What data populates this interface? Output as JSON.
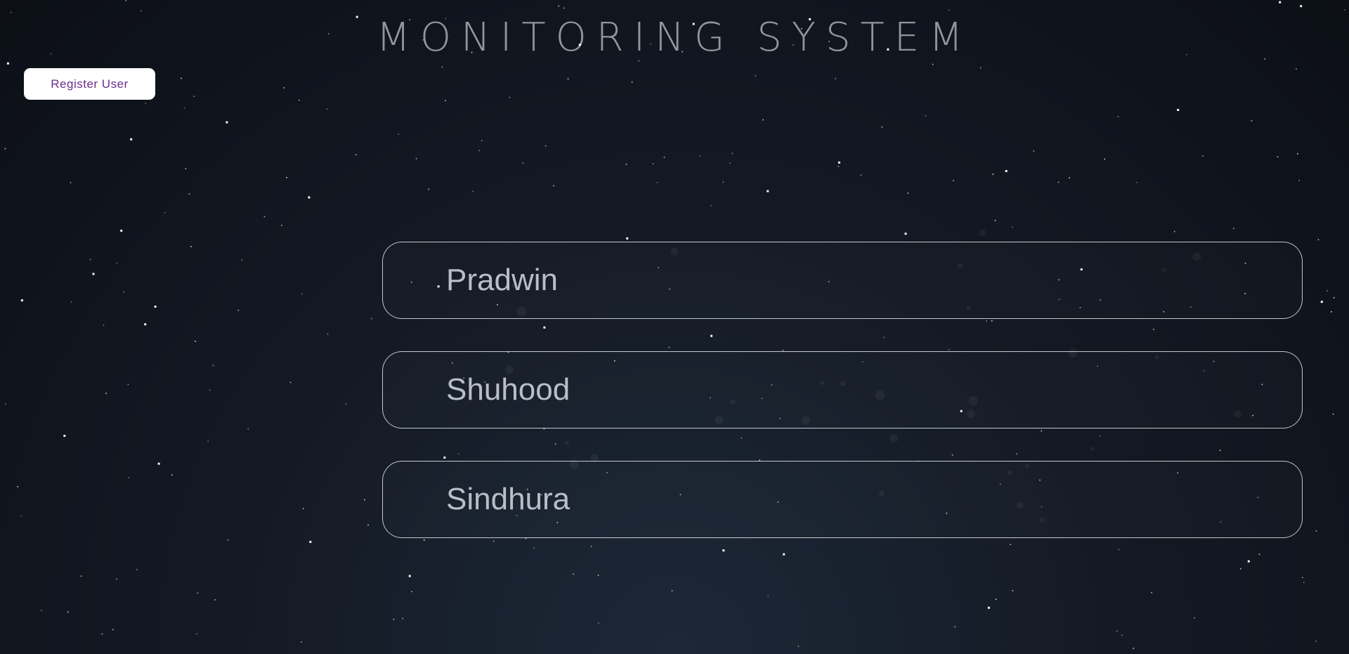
{
  "header": {
    "title": "MONITORING SYSTEM"
  },
  "actions": {
    "register_label": "Register User"
  },
  "users": [
    {
      "name": "Pradwin"
    },
    {
      "name": "Shuhood"
    },
    {
      "name": "Sindhura"
    }
  ],
  "colors": {
    "background_center": "#1c2837",
    "background_edge": "#0c0f16",
    "title": "#8e939b",
    "register_text": "#6b2c8c",
    "card_border": "#d9dbe0",
    "card_text": "#b9bec6"
  }
}
